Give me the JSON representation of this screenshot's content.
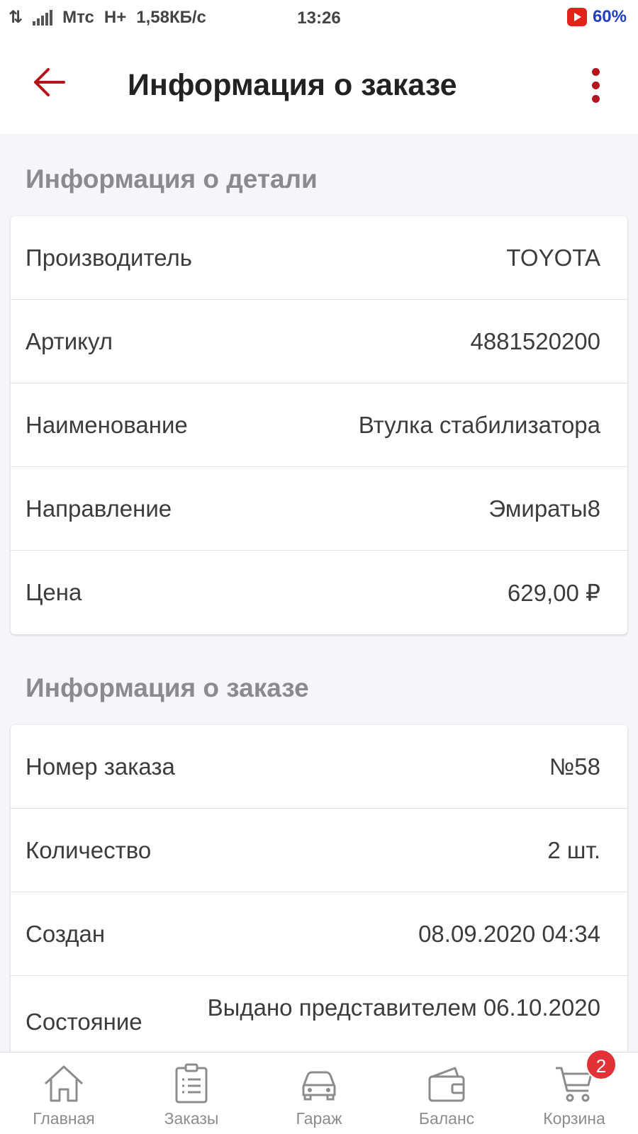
{
  "status_bar": {
    "carrier": "Мтс",
    "network": "H+",
    "speed": "1,58КБ/с",
    "time": "13:26",
    "battery": "60%"
  },
  "header": {
    "title": "Информация о заказе",
    "back_icon": "arrow-left-icon",
    "menu_icon": "more-vertical-icon"
  },
  "part_section": {
    "title": "Информация о детали",
    "rows": [
      {
        "label": "Производитель",
        "value": "TOYOTA"
      },
      {
        "label": "Артикул",
        "value": "4881520200"
      },
      {
        "label": "Наименование",
        "value": "Втулка стабилизатора"
      },
      {
        "label": "Направление",
        "value": "Эмираты8"
      },
      {
        "label": "Цена",
        "value": "629,00 ₽"
      }
    ]
  },
  "order_section": {
    "title": "Информация о заказе",
    "rows": [
      {
        "label": "Номер заказа",
        "value": "№58"
      },
      {
        "label": "Количество",
        "value": "2 шт."
      },
      {
        "label": "Создан",
        "value": "08.09.2020 04:34"
      },
      {
        "label": "Состояние",
        "value": "Выдано представителем 06.10.2020"
      }
    ]
  },
  "bottom_nav": {
    "items": [
      {
        "label": "Главная",
        "icon": "home-icon"
      },
      {
        "label": "Заказы",
        "icon": "clipboard-list-icon"
      },
      {
        "label": "Гараж",
        "icon": "car-icon"
      },
      {
        "label": "Баланс",
        "icon": "wallet-icon"
      },
      {
        "label": "Корзина",
        "icon": "cart-icon"
      }
    ],
    "cart_badge": "2"
  },
  "colors": {
    "accent": "#b5141c",
    "badge": "#e33237",
    "background": "#f5f6fa",
    "section_title": "#8a8a8f"
  }
}
